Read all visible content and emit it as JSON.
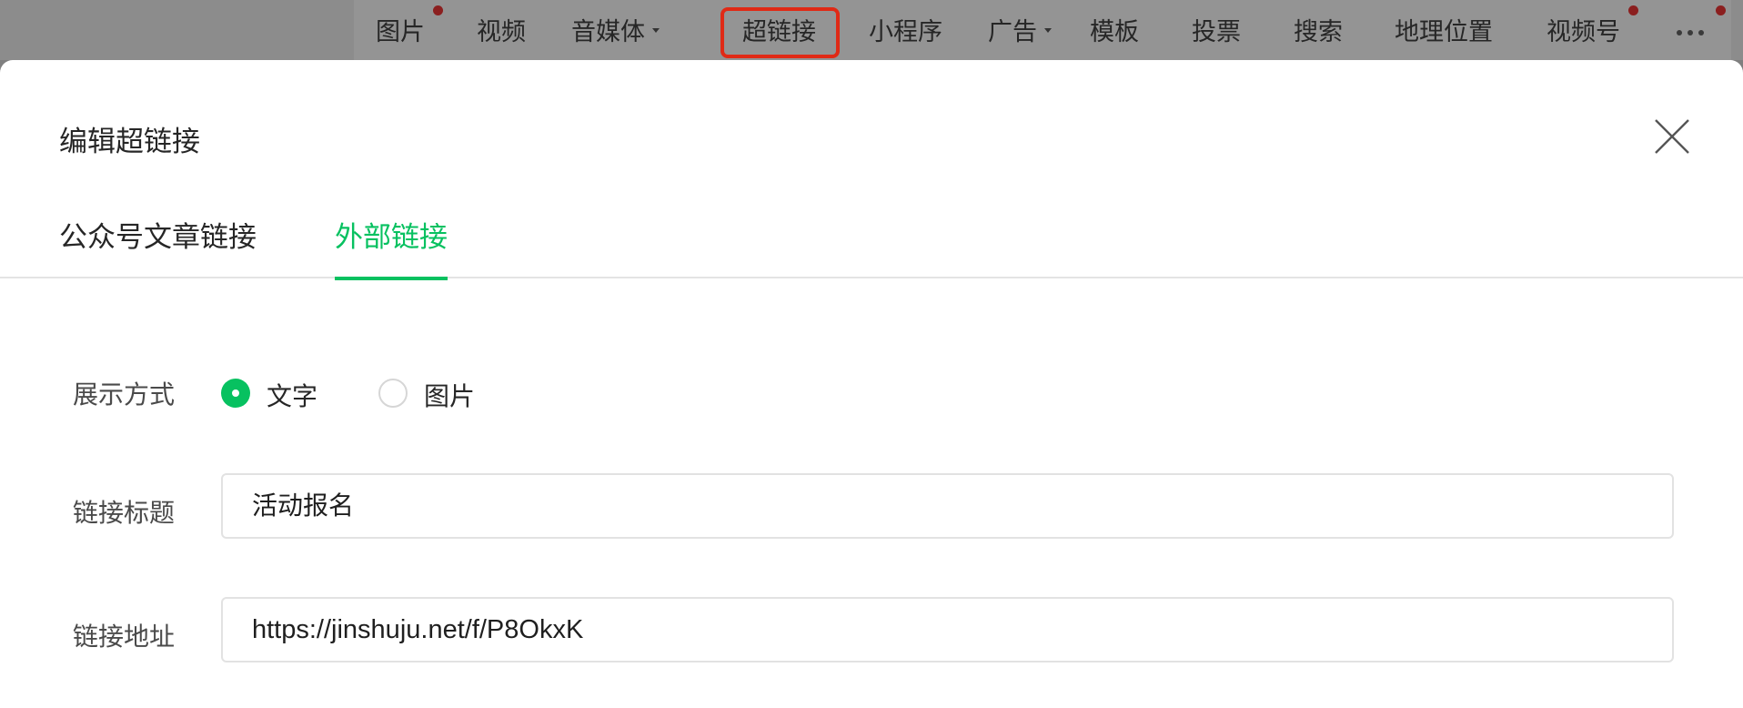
{
  "toolbar": {
    "items": [
      {
        "label": "图片"
      },
      {
        "label": "视频"
      },
      {
        "label": "音媒体"
      },
      {
        "label": "超链接"
      },
      {
        "label": "小程序"
      },
      {
        "label": "广告"
      },
      {
        "label": "模板"
      },
      {
        "label": "投票"
      },
      {
        "label": "搜索"
      },
      {
        "label": "地理位置"
      },
      {
        "label": "视频号"
      }
    ],
    "more_icon": "more-horizontal-icon",
    "highlight_color": "#e02a16",
    "badge_color": "#8b1f1f"
  },
  "dialog": {
    "title": "编辑超链接",
    "close_icon": "close-icon",
    "tabs": [
      {
        "label": "公众号文章链接"
      },
      {
        "label": "外部链接"
      }
    ],
    "active_tab": "外部链接",
    "accent_color": "#07c160"
  },
  "form": {
    "display_label": "展示方式",
    "display_options": [
      {
        "label": "文字"
      },
      {
        "label": "图片"
      }
    ],
    "display_selected": "文字",
    "title_label": "链接标题",
    "title_value": "活动报名",
    "url_label": "链接地址",
    "url_value": "https://jinshuju.net/f/P8OkxK"
  }
}
